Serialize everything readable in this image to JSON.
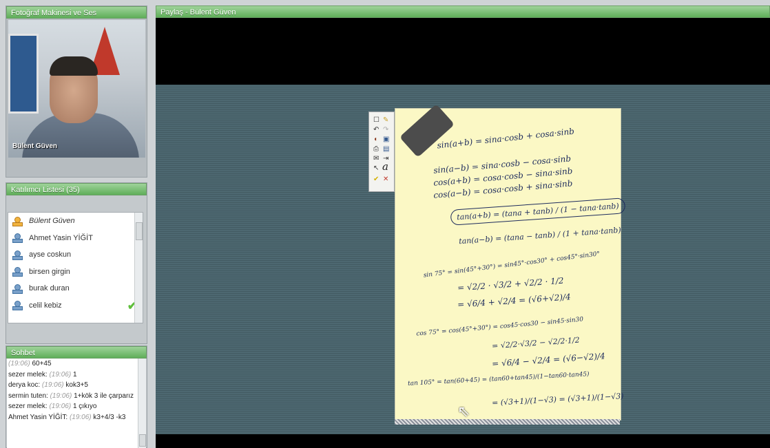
{
  "camera_panel": {
    "title": "Fotoğraf Makinesi ve Ses",
    "name_overlay": "Bülent Güven"
  },
  "participants_panel": {
    "title": "Katılımcı Listesi (35)",
    "items": [
      {
        "name": "Bülent Güven",
        "role": "host",
        "status": ""
      },
      {
        "name": "Ahmet Yasin YİĞİT",
        "role": "participant",
        "status": ""
      },
      {
        "name": "ayse coskun",
        "role": "participant",
        "status": ""
      },
      {
        "name": "birsen girgin",
        "role": "participant",
        "status": ""
      },
      {
        "name": "burak duran",
        "role": "participant",
        "status": ""
      },
      {
        "name": "celil kebiz",
        "role": "participant",
        "status": "check"
      }
    ]
  },
  "chat_panel": {
    "title": "Sohbet",
    "messages": [
      {
        "user": "",
        "time": "(19:06)",
        "text": "60+45"
      },
      {
        "user": "sezer melek:",
        "time": "(19:06)",
        "text": "1"
      },
      {
        "user": "derya koc:",
        "time": "(19:06)",
        "text": "kok3+5"
      },
      {
        "user": "sermin tuten:",
        "time": "(19:06)",
        "text": "1+kök 3 ile çarparız"
      },
      {
        "user": "sezer melek:",
        "time": "(19:06)",
        "text": "1 çıkıyo"
      },
      {
        "user": "Ahmet Yasin YİĞİT:",
        "time": "(19:06)",
        "text": "k3+4/3 -k3"
      }
    ]
  },
  "share_panel": {
    "title": "Paylaş - Bülent Güven",
    "whiteboard_lines": [
      "sin(a+b) = sina·cosb + cosa·sinb",
      "sin(a−b) = sina·cosb − cosa·sinb",
      "cos(a+b) = cosa·cosb − sina·sinb",
      "cos(a−b) = cosa·cosb + sina·sinb",
      "tan(a+b) = (tana + tanb) / (1 − tana·tanb)",
      "tan(a−b) = (tana − tanb) / (1 + tana·tanb)",
      "sin 75° = sin(45°+30°) = sin45°·cos30° + cos45°·sin30°",
      "= √2/2 · √3/2 + √2/2 · 1/2",
      "= √6/4 + √2/4 = (√6+√2)/4",
      "cos 75° = cos(45°+30°) = cos45·cos30 − sin45·sin30",
      "= √2/2·√3/2 − √2/2·1/2",
      "= √6/4 − √2/4 = (√6−√2)/4",
      "tan 105° = tan(60+45) = (tan60+tan45)/(1−tan60·tan45)",
      "= (√3+1)/(1−√3) = (√3+1)/(1−√3)"
    ],
    "tool_icons": [
      "rectangle-icon",
      "eraser-icon",
      "undo-icon",
      "redo-icon",
      "ink-icon",
      "paste-icon",
      "print-icon",
      "save-icon",
      "mail-icon",
      "export-icon",
      "pointer-icon",
      "text-icon",
      "check-icon",
      "delete-icon"
    ]
  }
}
